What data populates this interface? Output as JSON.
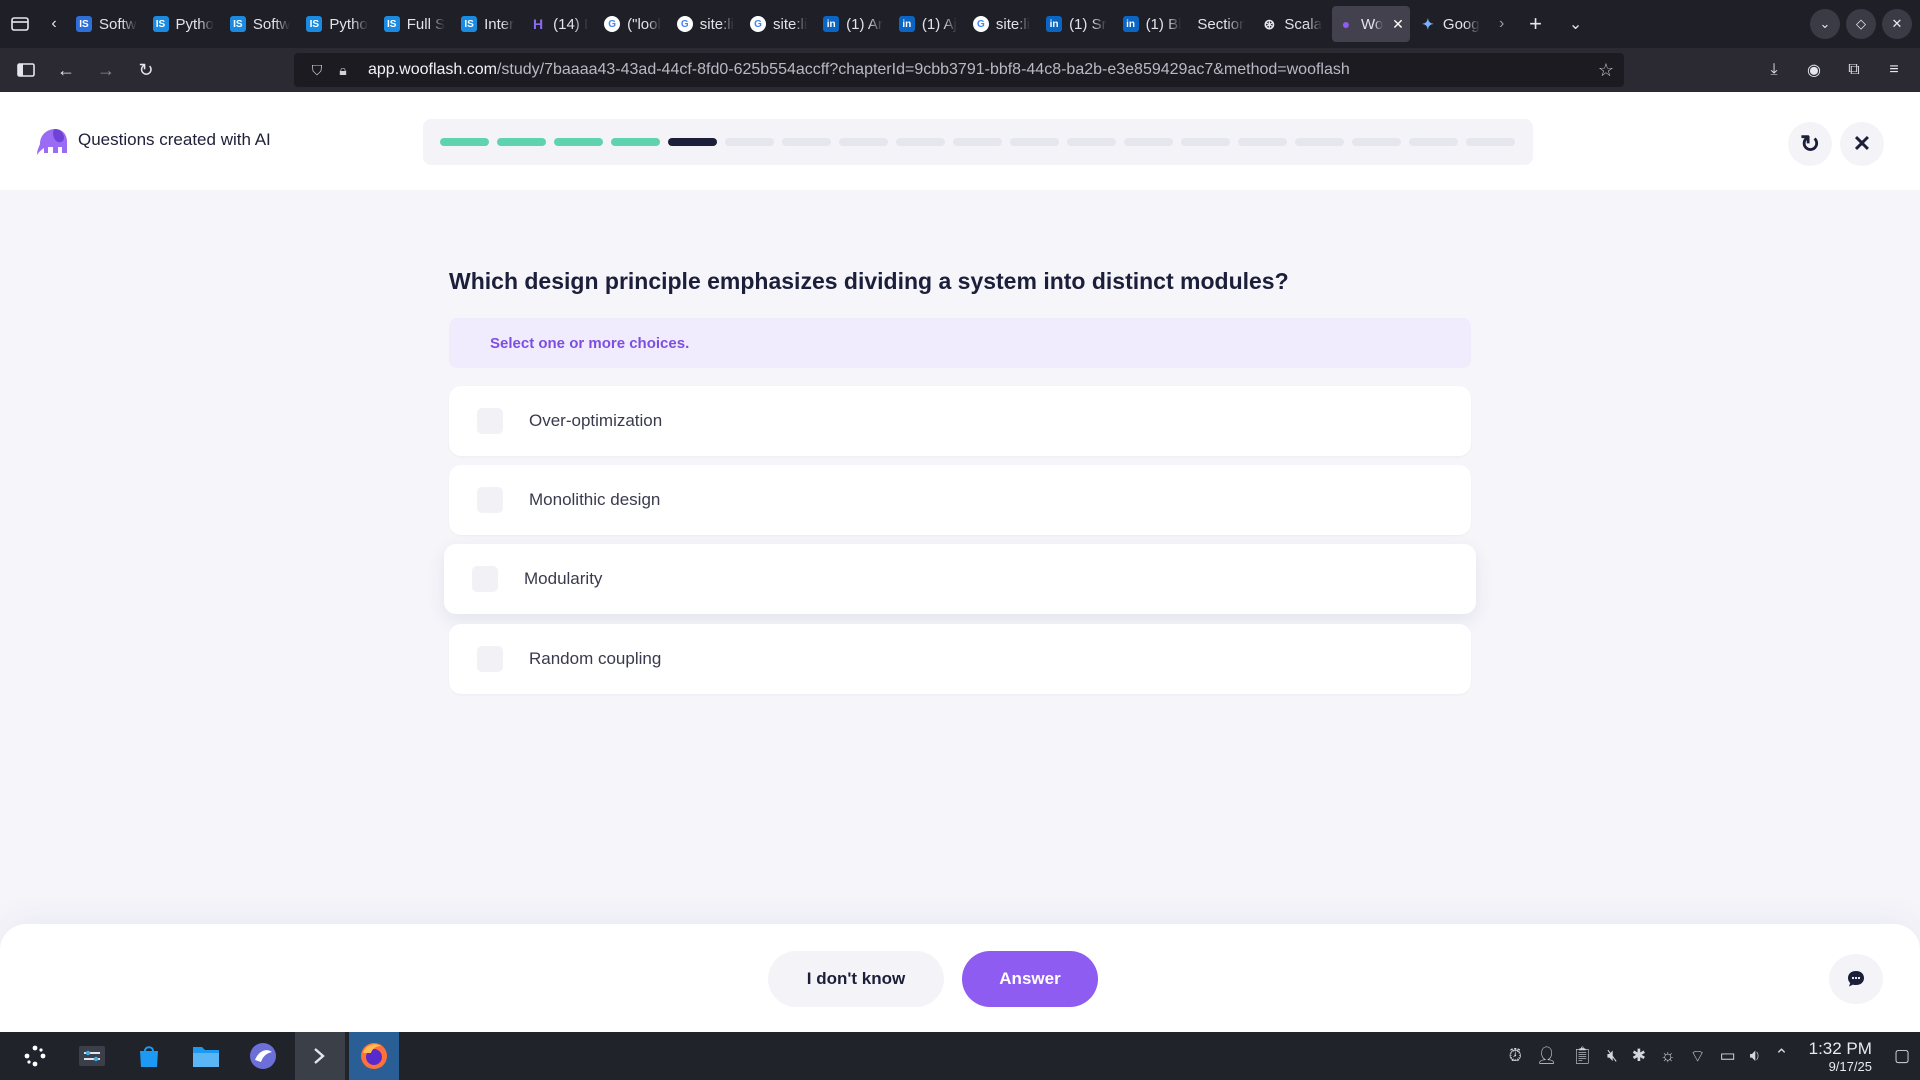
{
  "browser": {
    "tabs": [
      {
        "label": "Softw",
        "icon": "is-icon",
        "color": "#2f6fd8",
        "glyph": "IS"
      },
      {
        "label": "Pytho",
        "icon": "is-icon",
        "color": "#1a8be0",
        "glyph": "IS"
      },
      {
        "label": "Softw",
        "icon": "is-icon",
        "color": "#1a8be0",
        "glyph": "IS"
      },
      {
        "label": "Pytho",
        "icon": "is-icon",
        "color": "#1a8be0",
        "glyph": "IS"
      },
      {
        "label": "Full S",
        "icon": "is-icon",
        "color": "#1a8be0",
        "glyph": "IS"
      },
      {
        "label": "Inter",
        "icon": "is-icon",
        "color": "#1a8be0",
        "glyph": "IS"
      },
      {
        "label": "(14) I",
        "icon": "hackerrank-icon",
        "color": "#6b4bd6",
        "glyph": "H"
      },
      {
        "label": "(\"lool",
        "icon": "google-icon",
        "color": "#ffffff",
        "glyph": "G"
      },
      {
        "label": "site:li",
        "icon": "google-icon",
        "color": "#ffffff",
        "glyph": "G"
      },
      {
        "label": "site:li",
        "icon": "google-icon",
        "color": "#ffffff",
        "glyph": "G"
      },
      {
        "label": "(1) Ar",
        "icon": "linkedin-icon",
        "color": "#0a66c2",
        "glyph": "in"
      },
      {
        "label": "(1) Aj",
        "icon": "linkedin-icon",
        "color": "#0a66c2",
        "glyph": "in"
      },
      {
        "label": "site:li",
        "icon": "google-icon",
        "color": "#ffffff",
        "glyph": "G"
      },
      {
        "label": "(1) Sr",
        "icon": "linkedin-icon",
        "color": "#0a66c2",
        "glyph": "in"
      },
      {
        "label": "(1) Bl",
        "icon": "linkedin-icon",
        "color": "#0a66c2",
        "glyph": "in"
      },
      {
        "label": "Section:",
        "icon": "",
        "color": "",
        "glyph": ""
      },
      {
        "label": "Scala",
        "icon": "openai-icon",
        "color": "#1f1f28",
        "glyph": "⊛"
      },
      {
        "label": "Wo",
        "icon": "wooflash-icon",
        "color": "#8e5cf0",
        "glyph": "●",
        "active": true
      },
      {
        "label": "Goog",
        "icon": "gemini-icon",
        "color": "#1f1f28",
        "glyph": "✦"
      }
    ],
    "url_domain": "app.wooflash.com",
    "url_path": "/study/7baaaa43-43ad-44cf-8fd0-625b554accff?chapterId=9cbb3791-bbf8-44c8-ba2b-e3e859429ac7&method=wooflash"
  },
  "app": {
    "title": "Questions created with AI",
    "progress": {
      "total": 19,
      "completed": 4,
      "current": 5
    }
  },
  "question": {
    "text": "Which design principle emphasizes dividing a system into distinct modules?",
    "hint": "Select one or more choices.",
    "choices": [
      {
        "label": "Over-optimization"
      },
      {
        "label": "Monolithic design"
      },
      {
        "label": "Modularity"
      },
      {
        "label": "Random coupling"
      }
    ]
  },
  "actions": {
    "dont_know": "I don't know",
    "answer": "Answer"
  },
  "colors": {
    "accent": "#8e5cf0",
    "progress_done": "#5fd3ae",
    "progress_current": "#1c1f3a"
  },
  "taskbar": {
    "time": "1:32 PM",
    "date": "9/17/25"
  }
}
